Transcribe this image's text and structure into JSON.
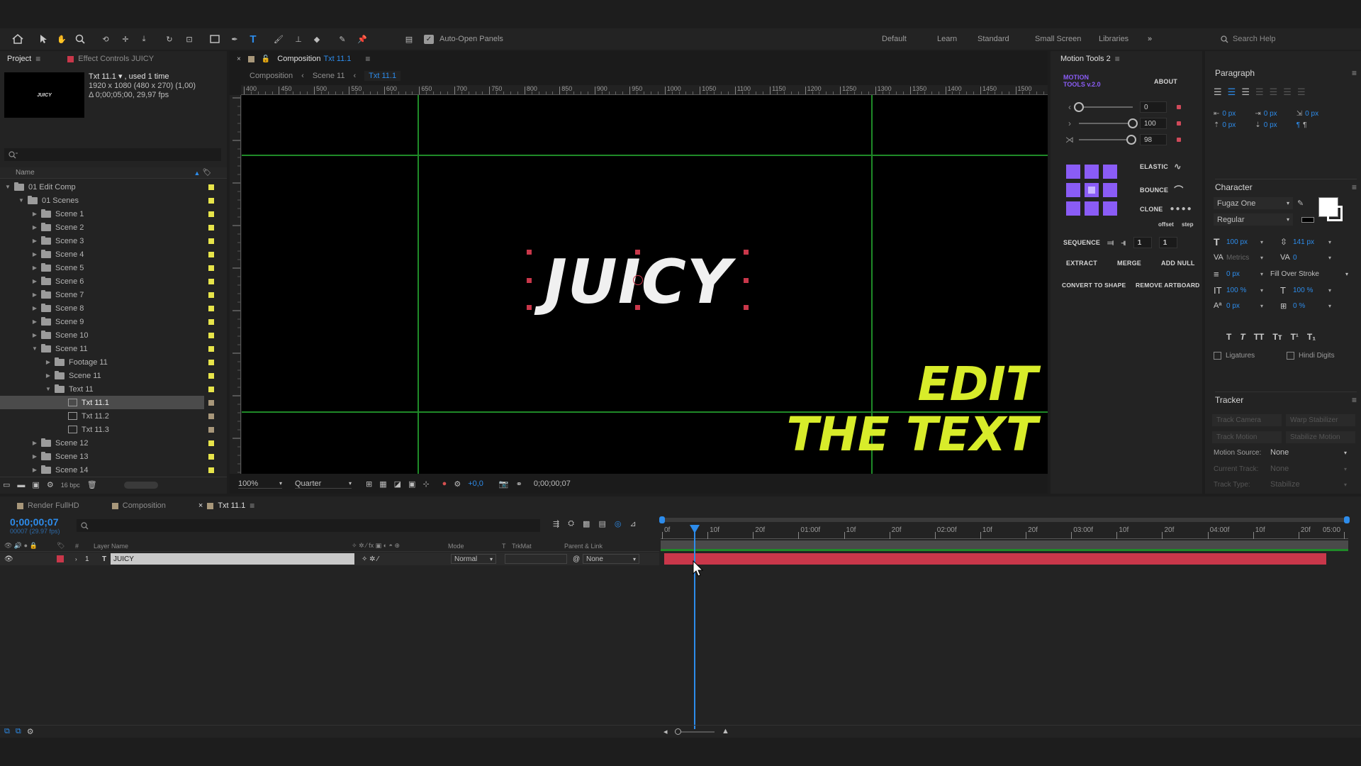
{
  "toolbar": {
    "auto_open_panels": "Auto-Open Panels",
    "workspaces": [
      "Default",
      "Learn",
      "Standard",
      "Small Screen",
      "Libraries"
    ],
    "search_help": "Search Help"
  },
  "project": {
    "tab_project": "Project",
    "tab_effect_controls": "Effect Controls JUICY",
    "thumb_text": "JUICY",
    "info_title": "Txt 11.1 ▾ , used 1 time",
    "info_size": "1920 x 1080  (480 x 270) (1,00)",
    "info_duration": "Δ 0;00;05;00, 29,97 fps",
    "col_name": "Name",
    "items": [
      {
        "label": "01 Edit Comp",
        "indent": 0,
        "kind": "folder",
        "open": true,
        "color": "#e7e44a"
      },
      {
        "label": "01 Scenes",
        "indent": 1,
        "kind": "folder",
        "open": true,
        "color": "#e7e44a"
      },
      {
        "label": "Scene 1",
        "indent": 2,
        "kind": "folder",
        "open": false,
        "color": "#e7e44a"
      },
      {
        "label": "Scene 2",
        "indent": 2,
        "kind": "folder",
        "open": false,
        "color": "#e7e44a"
      },
      {
        "label": "Scene 3",
        "indent": 2,
        "kind": "folder",
        "open": false,
        "color": "#e7e44a"
      },
      {
        "label": "Scene 4",
        "indent": 2,
        "kind": "folder",
        "open": false,
        "color": "#e7e44a"
      },
      {
        "label": "Scene 5",
        "indent": 2,
        "kind": "folder",
        "open": false,
        "color": "#e7e44a"
      },
      {
        "label": "Scene 6",
        "indent": 2,
        "kind": "folder",
        "open": false,
        "color": "#e7e44a"
      },
      {
        "label": "Scene 7",
        "indent": 2,
        "kind": "folder",
        "open": false,
        "color": "#e7e44a"
      },
      {
        "label": "Scene 8",
        "indent": 2,
        "kind": "folder",
        "open": false,
        "color": "#e7e44a"
      },
      {
        "label": "Scene 9",
        "indent": 2,
        "kind": "folder",
        "open": false,
        "color": "#e7e44a"
      },
      {
        "label": "Scene 10",
        "indent": 2,
        "kind": "folder",
        "open": false,
        "color": "#e7e44a"
      },
      {
        "label": "Scene 11",
        "indent": 2,
        "kind": "folder",
        "open": true,
        "color": "#e7e44a"
      },
      {
        "label": "Footage 11",
        "indent": 3,
        "kind": "folder",
        "open": false,
        "color": "#e7e44a"
      },
      {
        "label": "Scene 11",
        "indent": 3,
        "kind": "folder",
        "open": false,
        "color": "#e7e44a"
      },
      {
        "label": "Text 11",
        "indent": 3,
        "kind": "folder",
        "open": true,
        "color": "#e7e44a"
      },
      {
        "label": "Txt 11.1",
        "indent": 4,
        "kind": "comp",
        "open": null,
        "color": "#a8977a"
      },
      {
        "label": "Txt 11.2",
        "indent": 4,
        "kind": "comp",
        "open": null,
        "color": "#a8977a"
      },
      {
        "label": "Txt 11.3",
        "indent": 4,
        "kind": "comp",
        "open": null,
        "color": "#a8977a"
      },
      {
        "label": "Scene 12",
        "indent": 2,
        "kind": "folder",
        "open": false,
        "color": "#e7e44a"
      },
      {
        "label": "Scene 13",
        "indent": 2,
        "kind": "folder",
        "open": false,
        "color": "#e7e44a"
      },
      {
        "label": "Scene 14",
        "indent": 2,
        "kind": "folder",
        "open": false,
        "color": "#e7e44a"
      }
    ],
    "selected_index": 16,
    "bpc": "16 bpc"
  },
  "composition": {
    "tab_prefix": "Composition",
    "tab_name": "Txt 11.1",
    "breadcrumbs": [
      "Composition",
      "Scene 11",
      "Txt 11.1"
    ],
    "ruler_labels": [
      "400",
      "450",
      "500",
      "550",
      "600",
      "650",
      "700",
      "750",
      "800",
      "850",
      "900",
      "950",
      "1000",
      "1050",
      "1100",
      "1150",
      "1200",
      "1250",
      "1300",
      "1350",
      "1400",
      "1450",
      "1500"
    ],
    "canvas_text": "JUICY",
    "zoom": "100%",
    "resolution": "Quarter",
    "exposure": "+0,0",
    "timecode": "0;00;00;07"
  },
  "overlay": {
    "line1": "EDIT",
    "line2": "THE TEXT",
    "color": "#d8ec2a"
  },
  "motion_tools": {
    "title": "Motion Tools 2",
    "logo_line1": "MOTION",
    "logo_line2": "TOOLS v.2.0",
    "about": "ABOUT",
    "slider_values": [
      "0",
      "100",
      "98"
    ],
    "elastic": "ELASTIC",
    "bounce": "BOUNCE",
    "clone": "CLONE",
    "offset": "offset",
    "step": "step",
    "sequence": "SEQUENCE",
    "seq_values": [
      "1",
      "1"
    ],
    "extract": "EXTRACT",
    "merge": "MERGE",
    "add_null": "ADD NULL",
    "convert_to_shape": "CONVERT TO SHAPE",
    "remove_artboard": "REMOVE ARTBOARD",
    "accent": "#8a5cf6"
  },
  "paragraph": {
    "title": "Paragraph",
    "indents": [
      "0 px",
      "0 px",
      "0 px",
      "0 px",
      "0 px"
    ]
  },
  "character": {
    "title": "Character",
    "font": "Fugaz One",
    "style": "Regular",
    "size": "100 px",
    "leading": "141 px",
    "kerning": "Metrics",
    "tracking": "0",
    "stroke": "0 px",
    "stroke_type": "Fill Over Stroke",
    "vscale": "100 %",
    "hscale": "100 %",
    "baseline": "0 px",
    "tsume": "0 %",
    "ligatures": "Ligatures",
    "hindi_digits": "Hindi Digits"
  },
  "tracker": {
    "title": "Tracker",
    "track_camera": "Track Camera",
    "warp_stabilizer": "Warp Stabilizer",
    "track_motion": "Track Motion",
    "stabilize_motion": "Stabilize Motion",
    "motion_source_label": "Motion Source:",
    "motion_source": "None",
    "current_track_label": "Current Track:",
    "current_track": "None",
    "track_type_label": "Track Type:",
    "track_type": "Stabilize"
  },
  "timeline": {
    "tabs": [
      "Render FullHD",
      "Composition",
      "Txt 11.1"
    ],
    "timecode": "0;00;00;07",
    "fps": "00007 (29.97 fps)",
    "col_layer_name": "Layer Name",
    "col_mode": "Mode",
    "col_t": "T",
    "col_trkmat": "TrkMat",
    "col_parent": "Parent & Link",
    "layer_index": "1",
    "layer_name": "JUICY",
    "layer_mode": "Normal",
    "layer_parent": "None",
    "ruler_labels": [
      "0f",
      "10f",
      "20f",
      "01:00f",
      "10f",
      "20f",
      "02:00f",
      "10f",
      "20f",
      "03:00f",
      "10f",
      "20f",
      "04:00f",
      "10f",
      "20f",
      "05:00"
    ],
    "playhead_frame": 7,
    "total_frames": 150,
    "layer_color": "#c9374a"
  }
}
